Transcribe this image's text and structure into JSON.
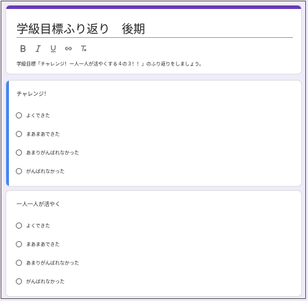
{
  "form": {
    "title": "学級目標ふり返り　後期",
    "description": "学級目標「チャレンジ！ー人一人が活やくする４の３！！」のふり返りをしましょう。",
    "toolbar": [
      "bold-icon",
      "italic-icon",
      "underline-icon",
      "link-icon",
      "clear-format-icon"
    ],
    "theme_color": "#673ab7",
    "background_color": "#f0ebf8",
    "active_accent_color": "#4285f4"
  },
  "questions": [
    {
      "title": "チャレンジ！",
      "options": [
        "よくできた",
        "まあまあできた",
        "あまりがんばれなかった",
        "がんばれなかった"
      ]
    },
    {
      "title": "一人一人が活やく",
      "options": [
        "よくできた",
        "まあまあできた",
        "あまりがんばれなかった",
        "がんばれなかった"
      ]
    }
  ]
}
